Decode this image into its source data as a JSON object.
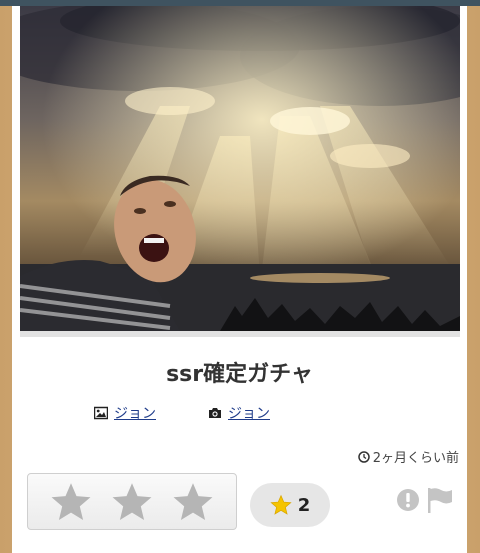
{
  "post": {
    "title": "ssr確定ガチャ",
    "image_author": "ジョン",
    "photo_author": "ジョン",
    "posted_time": "2ヶ月くらい前"
  },
  "rating": {
    "stars_total": 3,
    "stars_filled": 0
  },
  "favorites": {
    "count": "2"
  },
  "colors": {
    "link": "#1f3c8a",
    "star_gold": "#f5c400",
    "star_empty": "#b5b5b5",
    "topbar": "#3f5360"
  }
}
